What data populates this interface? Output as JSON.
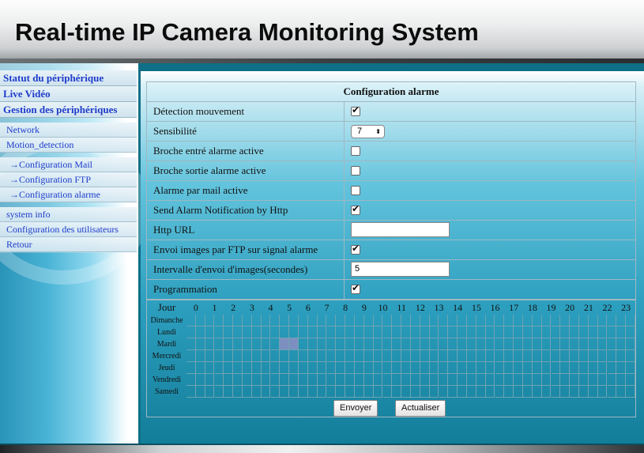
{
  "header": {
    "title": "Real-time IP Camera Monitoring System"
  },
  "nav": {
    "main": [
      "Statut du périphérique",
      "Live Vidéo",
      "Gestion des périphériques"
    ],
    "sub1": [
      "Network",
      "Motion_detection"
    ],
    "sub2": [
      "→Configuration Mail",
      "→Configuration FTP",
      "→Configuration alarme"
    ],
    "sub3": [
      "system info",
      "Configuration des utilisateurs",
      "Retour"
    ]
  },
  "form": {
    "title": "Configuration alarme",
    "rows": [
      {
        "label": "Détection mouvement",
        "type": "checkbox",
        "checked": true
      },
      {
        "label": "Sensibilité",
        "type": "select",
        "value": "7"
      },
      {
        "label": "Broche entré alarme active",
        "type": "checkbox",
        "checked": false
      },
      {
        "label": "Broche sortie alarme active",
        "type": "checkbox",
        "checked": false
      },
      {
        "label": "Alarme par mail active",
        "type": "checkbox",
        "checked": false
      },
      {
        "label": "Send Alarm Notification by Http",
        "type": "checkbox",
        "checked": true
      },
      {
        "label": "Http URL",
        "type": "text",
        "value": ""
      },
      {
        "label": "Envoi images par FTP sur signal alarme",
        "type": "checkbox",
        "checked": true
      },
      {
        "label": "Intervalle d'envoi d'images(secondes)",
        "type": "text",
        "value": "5"
      },
      {
        "label": "Programmation",
        "type": "checkbox",
        "checked": true
      }
    ]
  },
  "schedule": {
    "header": "Jour",
    "hours": [
      "0",
      "1",
      "2",
      "3",
      "4",
      "5",
      "6",
      "7",
      "8",
      "9",
      "10",
      "11",
      "12",
      "13",
      "14",
      "15",
      "16",
      "17",
      "18",
      "19",
      "20",
      "21",
      "22",
      "23"
    ],
    "days": [
      "Dimanche",
      "Lundi",
      "Mardi",
      "Mercredi",
      "Jeudi",
      "Vendredi",
      "Samedi"
    ],
    "active": [
      {
        "day": "Mardi",
        "hour": "5"
      }
    ]
  },
  "buttons": {
    "submit": "Envoyer",
    "refresh": "Actualiser"
  }
}
